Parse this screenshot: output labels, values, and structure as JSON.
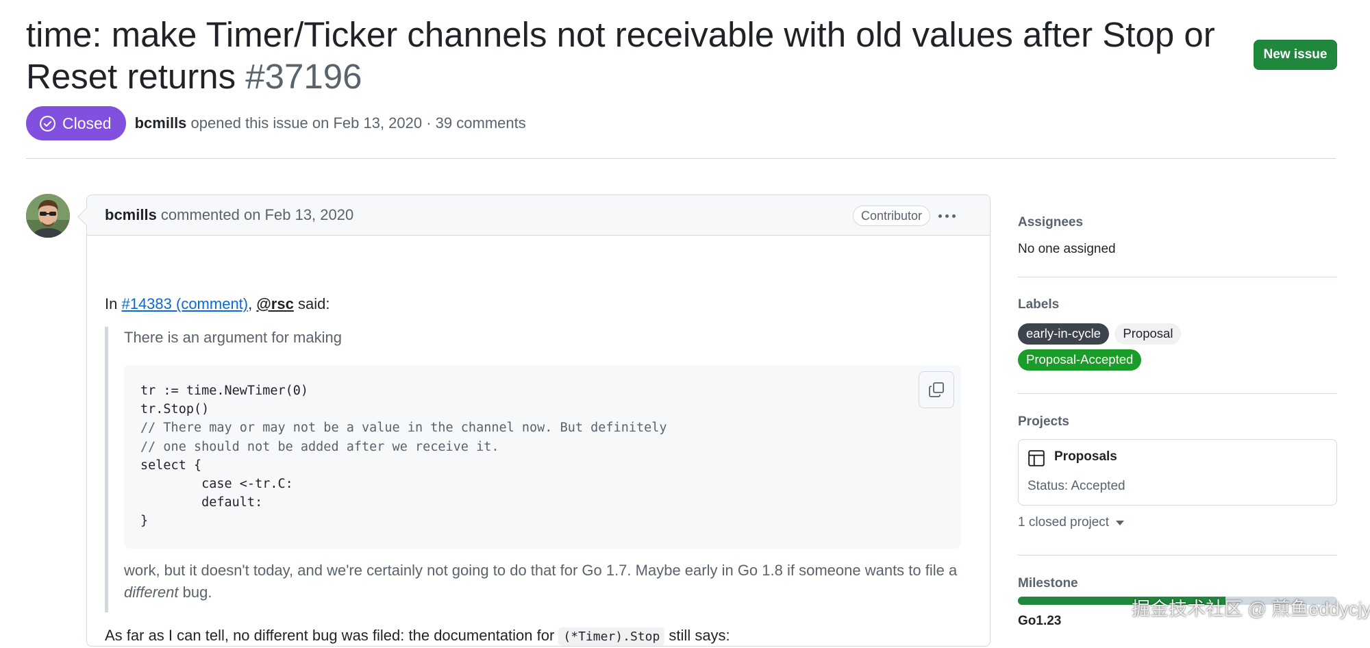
{
  "issue": {
    "title": "time: make Timer/Ticker channels not receivable with old values after Stop or Reset returns",
    "number": "#37196",
    "state": "Closed",
    "author": "bcmills",
    "opened_text": " opened this issue on Feb 13, 2020 · 39 comments",
    "new_issue_label": "New issue"
  },
  "comment": {
    "author": "bcmills",
    "date_text": " commented on Feb 13, 2020",
    "role": "Contributor",
    "intro_prefix": "In ",
    "intro_link": "#14383 (comment)",
    "intro_sep": ", ",
    "intro_mention": "@rsc",
    "intro_suffix": " said:",
    "quote_lead": "There is an argument for making",
    "code_lines": [
      "tr := time.NewTimer(0)",
      "tr.Stop()",
      "// There may or may not be a value in the channel now. But definitely",
      "// one should not be added after we receive it.",
      "select {",
      "        case <-tr.C:",
      "        default:",
      "}"
    ],
    "quote_tail_before": "work, but it doesn't today, and we're certainly not going to do that for Go 1.7. Maybe early in Go 1.8 if someone wants to file a ",
    "quote_tail_em": "different",
    "quote_tail_after": " bug.",
    "p2_before": "As far as I can tell, no different bug was filed: the documentation for ",
    "p2_code": "(*Timer).Stop",
    "p2_after": " still says:"
  },
  "sidebar": {
    "assignees_title": "Assignees",
    "assignees_value": "No one assigned",
    "labels_title": "Labels",
    "labels": [
      {
        "name": "early-in-cycle",
        "color": "#3d444d"
      },
      {
        "name": "Proposal",
        "color": "#eff1f3"
      },
      {
        "name": "Proposal-Accepted",
        "color": "#1a9c28"
      }
    ],
    "projects_title": "Projects",
    "project_name": "Proposals",
    "project_status": "Status: Accepted",
    "closed_projects": "1 closed project",
    "milestone_title": "Milestone",
    "milestone_progress": 0.65,
    "milestone_name": "Go1.23"
  },
  "watermark": "掘金技术社区 @ 煎鱼eddycjy",
  "colors": {
    "closed_badge": "#8250df",
    "new_issue_button": "#1f883d",
    "link": "#0969da"
  }
}
